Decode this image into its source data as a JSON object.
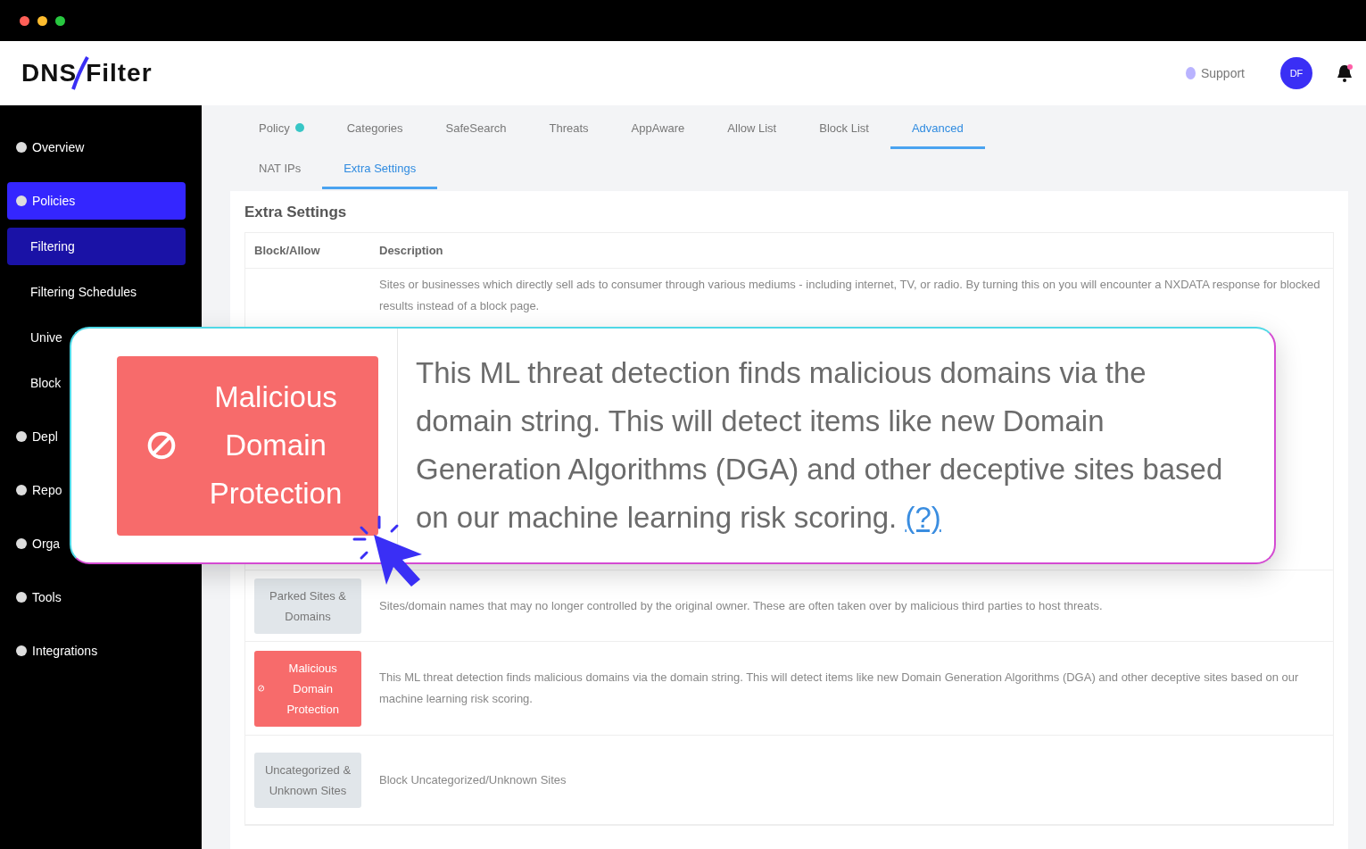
{
  "header": {
    "logo": {
      "left": "DNS",
      "right": "Filter"
    },
    "support": "Support",
    "avatar": "DF"
  },
  "sidebar": {
    "items": [
      {
        "label": "Overview",
        "selected": false,
        "sub": false
      },
      {
        "label": "Policies",
        "selected": true,
        "sub": false
      },
      {
        "label": "Filtering",
        "selected": true,
        "sub": true
      },
      {
        "label": "Filtering Schedules",
        "selected": false,
        "sub": true
      },
      {
        "label": "Unive",
        "selected": false,
        "sub": true
      },
      {
        "label": "Block",
        "selected": false,
        "sub": true
      },
      {
        "label": "Depl",
        "selected": false,
        "sub": false
      },
      {
        "label": "Repo",
        "selected": false,
        "sub": false
      },
      {
        "label": "Orga",
        "selected": false,
        "sub": false
      },
      {
        "label": "Tools",
        "selected": false,
        "sub": false
      },
      {
        "label": "Integrations",
        "selected": false,
        "sub": false
      }
    ]
  },
  "tabs": [
    {
      "label": "Policy",
      "selected": false
    },
    {
      "label": "Categories",
      "selected": false
    },
    {
      "label": "SafeSearch",
      "selected": false
    },
    {
      "label": "Threats",
      "selected": false
    },
    {
      "label": "AppAware",
      "selected": false
    },
    {
      "label": "Allow List",
      "selected": false
    },
    {
      "label": "Block List",
      "selected": false
    },
    {
      "label": "Advanced",
      "selected": true
    }
  ],
  "subtabs": [
    {
      "label": "NAT IPs",
      "selected": false
    },
    {
      "label": "Extra Settings",
      "selected": true
    }
  ],
  "card": {
    "title": "Extra Settings",
    "columns": [
      "Block/Allow",
      "Description"
    ],
    "rows": [
      {
        "description": "Sites or businesses which directly sell ads to consumer through various mediums - including internet, TV, or radio. By turning this on you will encounter a NXDATA response for blocked results instead of a block page."
      },
      {
        "badge": "Parked Sites & Domains",
        "blocked": false,
        "description": "Sites/domain names that may no longer controlled by the original owner. These are often taken over by malicious third parties to host threats."
      },
      {
        "badge": "Malicious Domain Protection",
        "blocked": true,
        "description": "This ML threat detection finds malicious domains via the domain string. This will detect items like new Domain Generation Algorithms (DGA) and other deceptive sites based on our machine learning risk scoring."
      },
      {
        "badge": "Uncategorized & Unknown Sites",
        "blocked": false,
        "description": "Block Uncategorized/Unknown Sites"
      }
    ]
  },
  "callout": {
    "badge": "Malicious Domain Protection",
    "blocked": true,
    "description": "This ML threat detection finds malicious domains via the domain string. This will detect items like new Domain Generation Algorithms (DGA) and other deceptive sites based on our machine learning risk scoring.",
    "help": "(?)"
  }
}
